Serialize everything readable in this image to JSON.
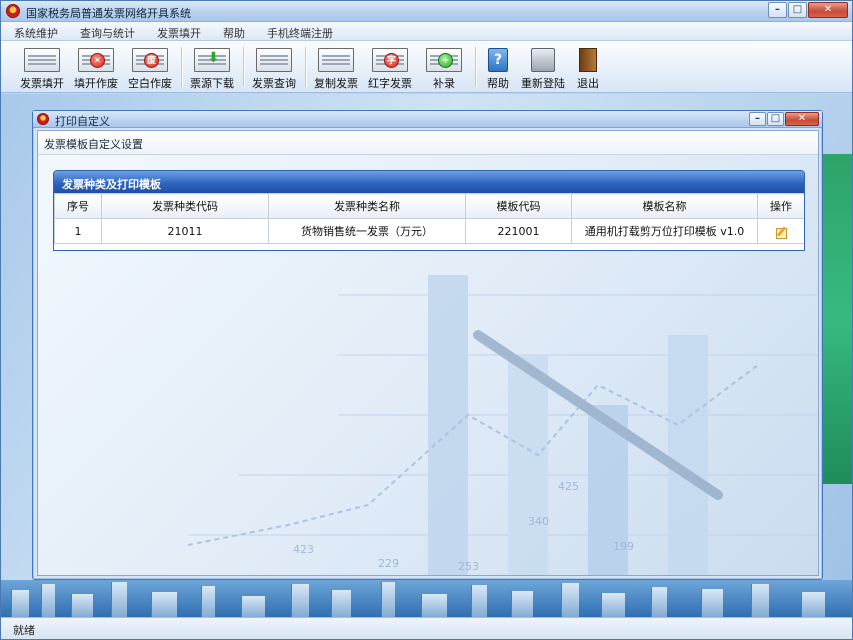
{
  "app": {
    "title": "国家税务局普通发票网络开具系统"
  },
  "window_controls": {
    "minimize": "–",
    "maximize": "□",
    "close": "✕"
  },
  "menubar": [
    {
      "label": "系统维护"
    },
    {
      "label": "查询与统计"
    },
    {
      "label": "发票填开"
    },
    {
      "label": "帮助"
    },
    {
      "label": "手机终端注册"
    }
  ],
  "toolbar": [
    {
      "label": "发票填开",
      "icon": "invoice-fill-icon"
    },
    {
      "label": "填开作废",
      "icon": "void-filled-icon",
      "badge": "✕"
    },
    {
      "label": "空白作废",
      "icon": "void-blank-icon",
      "badge": "废"
    },
    {
      "label": "票源下载",
      "icon": "download-icon",
      "badge": "⬇"
    },
    {
      "label": "发票查询",
      "icon": "search-invoice-icon"
    },
    {
      "label": "复制发票",
      "icon": "copy-invoice-icon"
    },
    {
      "label": "红字发票",
      "icon": "red-invoice-icon",
      "badge": "字"
    },
    {
      "label": "补录",
      "icon": "add-record-icon",
      "badge": "+"
    },
    {
      "label": "帮助",
      "icon": "help-icon",
      "badge": "?"
    },
    {
      "label": "重新登陆",
      "icon": "relogin-icon"
    },
    {
      "label": "退出",
      "icon": "exit-icon"
    }
  ],
  "dialog": {
    "title": "打印自定义",
    "header": "发票模板自定义设置",
    "panel_title": "发票种类及打印模板",
    "columns": [
      "序号",
      "发票种类代码",
      "发票种类名称",
      "模板代码",
      "模板名称",
      "操作"
    ],
    "rows": [
      {
        "index": "1",
        "type_code": "21011",
        "type_name": "货物销售统一发票（万元）",
        "template_code": "221001",
        "template_name": "通用机打载剪万位打印模板 v1.0"
      }
    ]
  },
  "background": {
    "numbers": [
      "423",
      "340",
      "425",
      "199",
      "253",
      "229"
    ]
  },
  "statusbar": {
    "text": "就绪"
  },
  "colors": {
    "accent": "#2f66c0",
    "title_bar": "#b9d1ee",
    "green_strip": "#37b980"
  }
}
